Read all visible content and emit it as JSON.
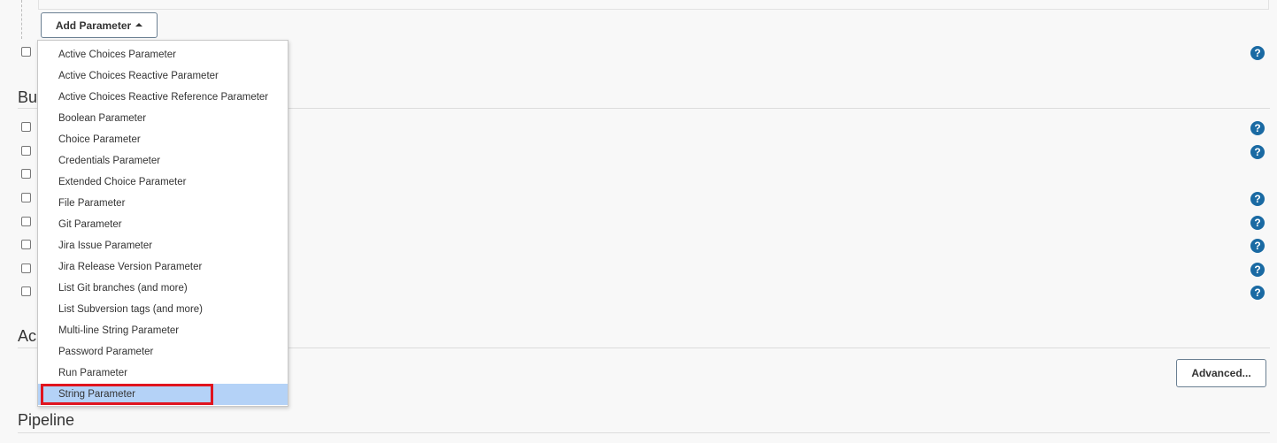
{
  "add_parameter": {
    "label": "Add Parameter",
    "caret_icon": "caret-up-icon"
  },
  "menu": {
    "items": [
      "Active Choices Parameter",
      "Active Choices Reactive Parameter",
      "Active Choices Reactive Reference Parameter",
      "Boolean Parameter",
      "Choice Parameter",
      "Credentials Parameter",
      "Extended Choice Parameter",
      "File Parameter",
      "Git Parameter",
      "Jira Issue Parameter",
      "Jira Release Version Parameter",
      "List Git branches (and more)",
      "List Subversion tags (and more)",
      "Multi-line String Parameter",
      "Password Parameter",
      "Run Parameter",
      "String Parameter"
    ],
    "selected_index": 16
  },
  "sections": {
    "build_partial": "Bu",
    "advanced_partial": "Ac",
    "pipeline": "Pipeline"
  },
  "buttons": {
    "advanced": "Advanced..."
  },
  "help_glyph": "?",
  "colors": {
    "help_icon": "#1a6aa3",
    "selected_item_bg": "#b4d2f7",
    "highlight_border": "#e0141e"
  }
}
